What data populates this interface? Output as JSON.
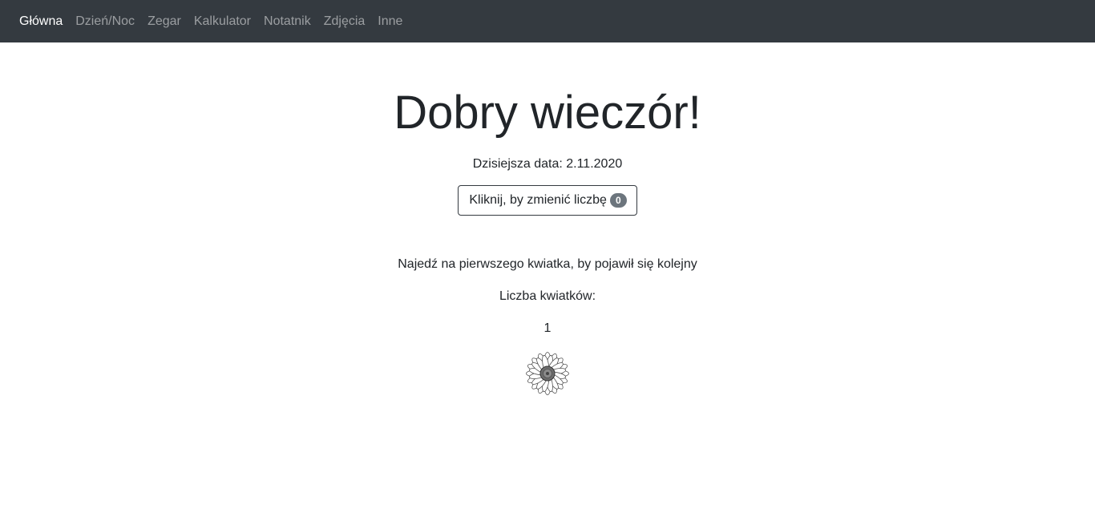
{
  "nav": {
    "items": [
      {
        "label": "Główna",
        "active": true
      },
      {
        "label": "Dzień/Noc",
        "active": false
      },
      {
        "label": "Zegar",
        "active": false
      },
      {
        "label": "Kalkulator",
        "active": false
      },
      {
        "label": "Notatnik",
        "active": false
      },
      {
        "label": "Zdjęcia",
        "active": false
      },
      {
        "label": "Inne",
        "active": false
      }
    ]
  },
  "main": {
    "greeting": "Dobry wieczór!",
    "date_line": "Dzisiejsza data: 2.11.2020",
    "button_label": "Kliknij, by zmienić liczbę",
    "button_badge": "0",
    "hint": "Najedź na pierwszego kwiatka, by pojawił się kolejny",
    "flower_count_label": "Liczba kwiatków:",
    "flower_count": "1",
    "flower_icon": "daisy-flower"
  },
  "colors": {
    "navbar_bg": "#343a40",
    "badge_bg": "#6c757d",
    "text": "#212529"
  }
}
